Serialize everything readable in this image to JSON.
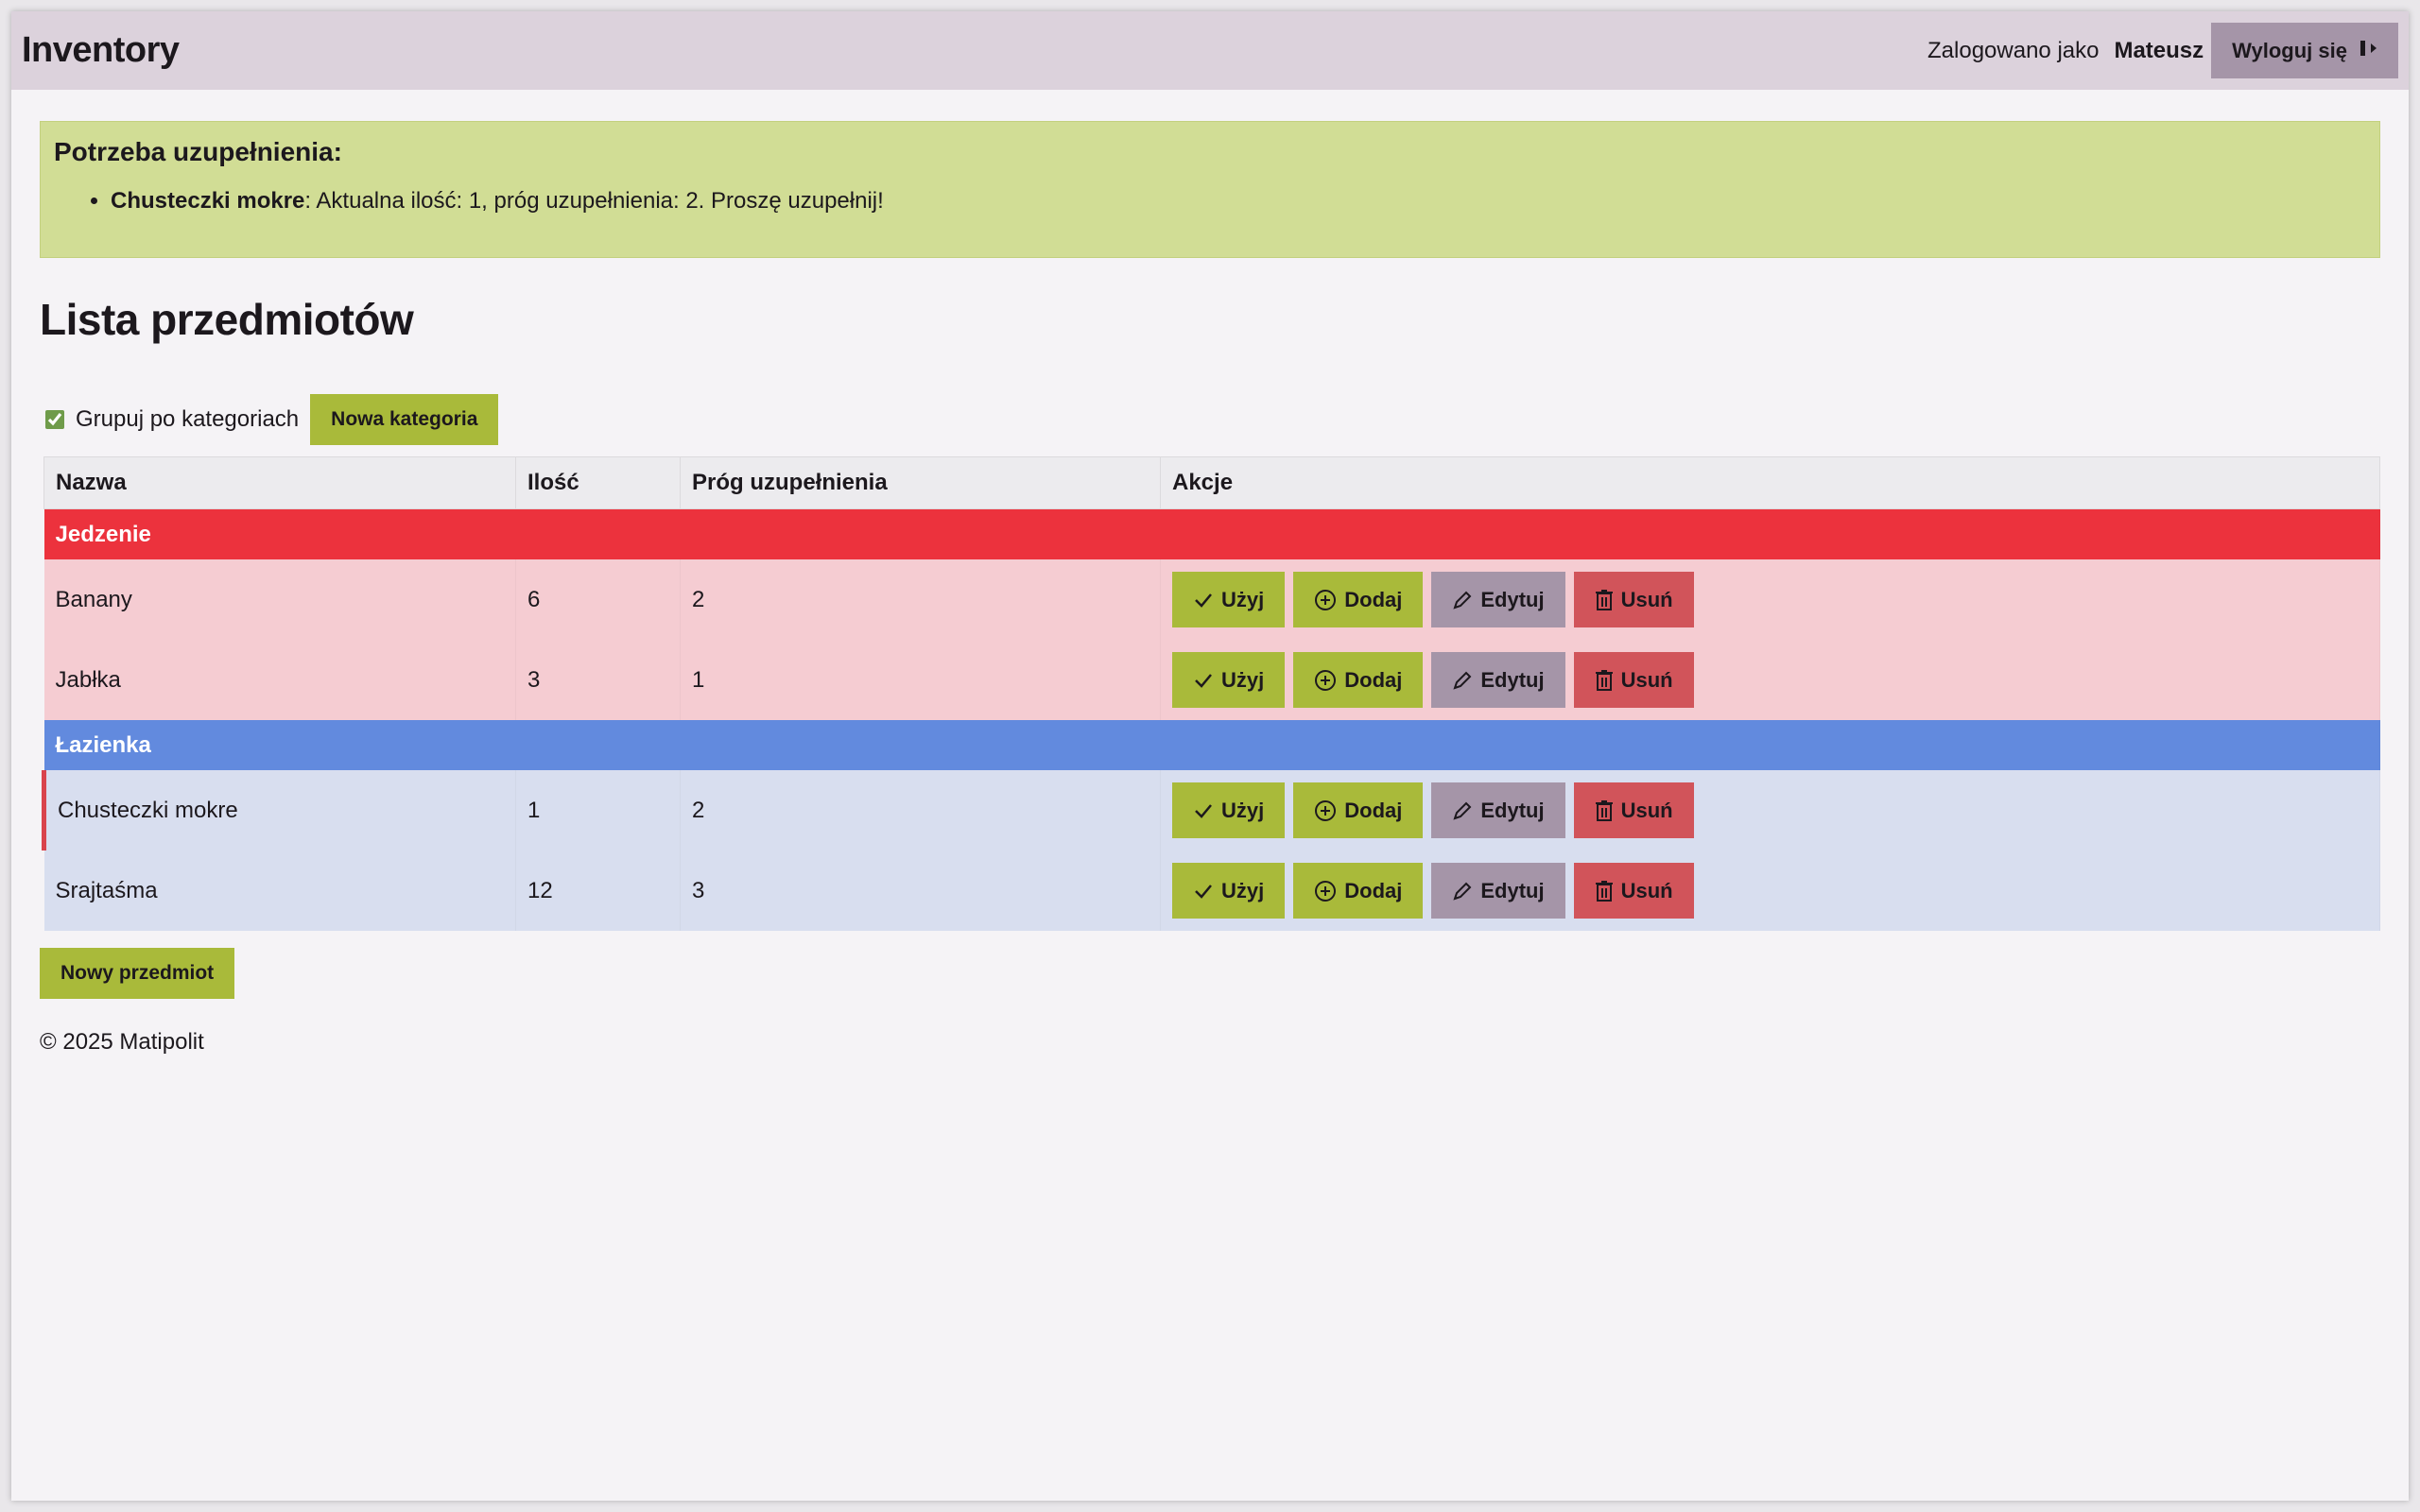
{
  "header": {
    "brand": "Inventory",
    "logged_in_as": "Zalogowano jako",
    "username": "Mateusz",
    "logout_label": "Wyloguj się"
  },
  "alert": {
    "title": "Potrzeba uzupełnienia:",
    "items": [
      {
        "name": "Chusteczki mokre",
        "message": ": Aktualna ilość: 1, próg uzupełnienia: 2. Proszę uzupełnij!"
      }
    ]
  },
  "page_title": "Lista przedmiotów",
  "controls": {
    "group_by_category_label": "Grupuj po kategoriach",
    "group_by_category_checked": true,
    "new_category_label": "Nowa kategoria"
  },
  "table": {
    "headers": [
      "Nazwa",
      "Ilość",
      "Próg uzupełnienia",
      "Akcje"
    ],
    "categories": [
      {
        "name": "Jedzenie",
        "color": "#ec323d",
        "row_color": "#f5ccd2",
        "items": [
          {
            "name": "Banany",
            "qty": "6",
            "threshold": "2",
            "low": false
          },
          {
            "name": "Jabłka",
            "qty": "3",
            "threshold": "1",
            "low": false
          }
        ]
      },
      {
        "name": "Łazienka",
        "color": "#628ade",
        "row_color": "#d8deef",
        "items": [
          {
            "name": "Chusteczki mokre",
            "qty": "1",
            "threshold": "2",
            "low": true
          },
          {
            "name": "Srajtaśma",
            "qty": "12",
            "threshold": "3",
            "low": false
          }
        ]
      }
    ],
    "actions": {
      "use": "Użyj",
      "add": "Dodaj",
      "edit": "Edytuj",
      "delete": "Usuń"
    }
  },
  "new_item_label": "Nowy przedmiot",
  "footer": "© 2025 Matipolit",
  "colors": {
    "topbar": "#dcd2dc",
    "accent_green": "#a9ba3a",
    "edit_purple": "#a595a8",
    "delete_red": "#d1545a",
    "alert_bg": "#d1dd95"
  }
}
